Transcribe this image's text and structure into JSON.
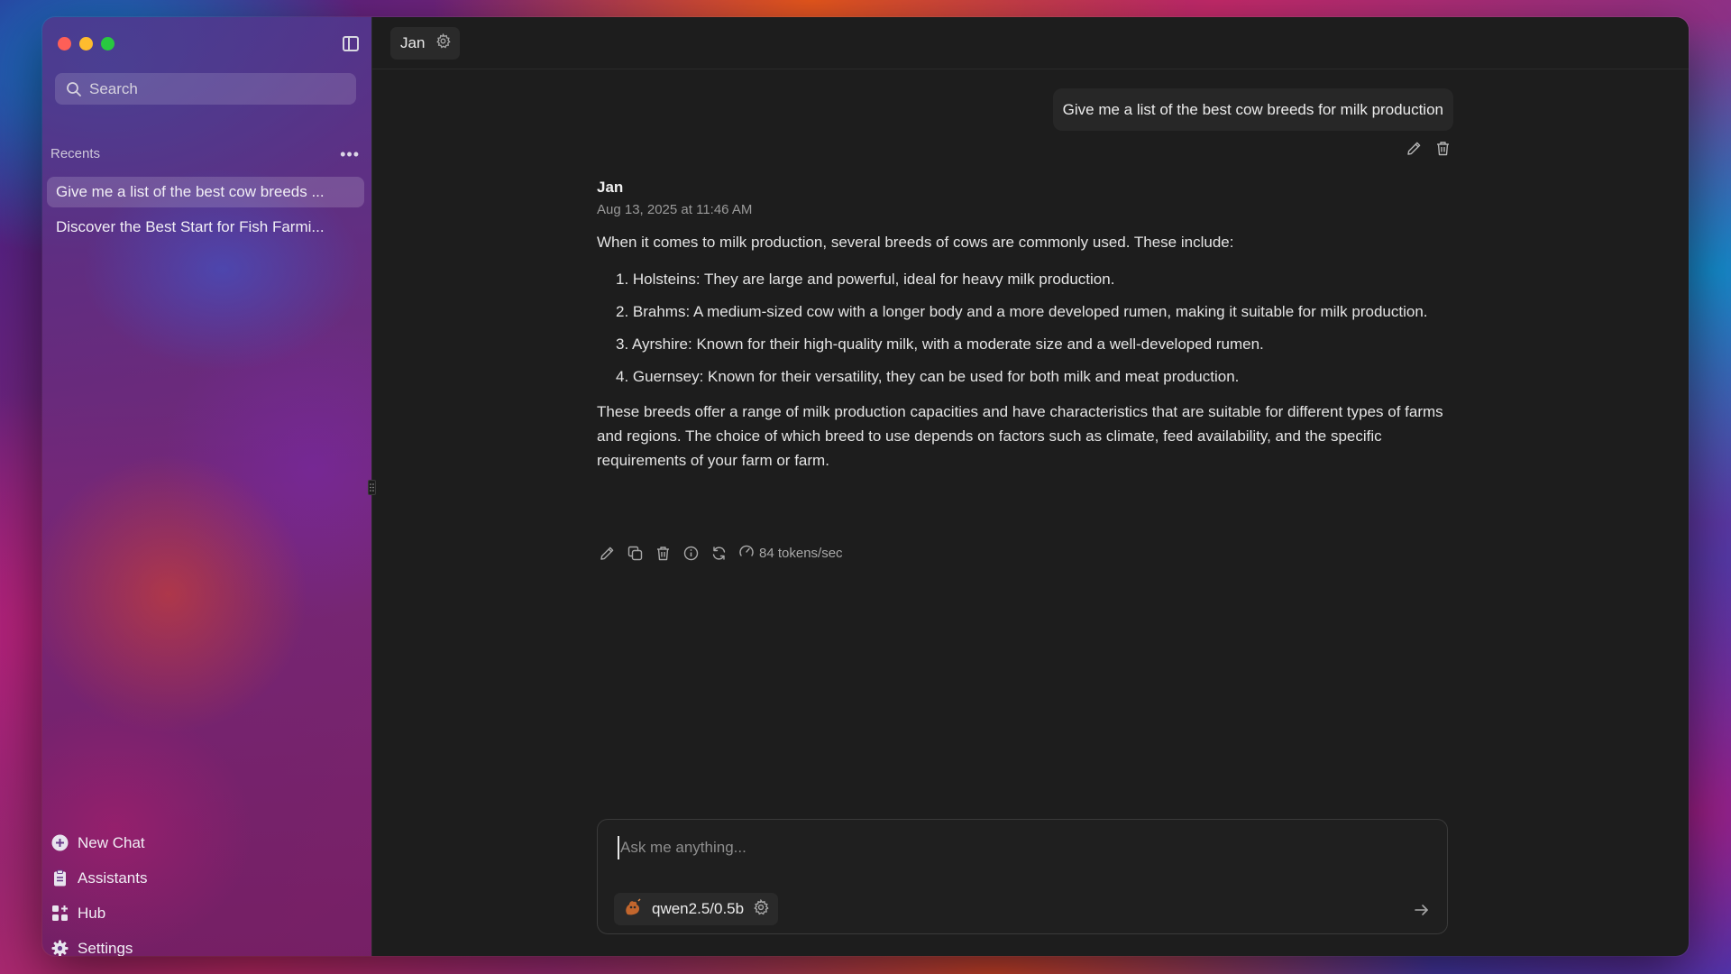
{
  "sidebar": {
    "search_placeholder": "Search",
    "recents_label": "Recents",
    "recents": [
      {
        "label": "Give me a list of the best cow breeds ..."
      },
      {
        "label": "Discover the Best Start for Fish Farmi..."
      }
    ],
    "nav": [
      {
        "label": "New Chat",
        "icon": "plus-circle-icon"
      },
      {
        "label": "Assistants",
        "icon": "clipboard-icon"
      },
      {
        "label": "Hub",
        "icon": "grid-icon"
      },
      {
        "label": "Settings",
        "icon": "gear-icon"
      }
    ]
  },
  "topbar": {
    "assistant_name": "Jan"
  },
  "conversation": {
    "user_message": "Give me a list of the best cow breeds for milk production",
    "assistant": {
      "name": "Jan",
      "timestamp": "Aug 13, 2025 at 11:46 AM",
      "intro": "When it comes to milk production, several breeds of cows are commonly used. These include:",
      "items": [
        "1. Holsteins: They are large and powerful, ideal for heavy milk production.",
        "2. Brahms: A medium-sized cow with a longer body and a more developed rumen, making it suitable for milk production.",
        "3. Ayrshire: Known for their high-quality milk, with a moderate size and a well-developed rumen.",
        "4. Guernsey: Known for their versatility, they can be used for both milk and meat production."
      ],
      "outro": "These breeds offer a range of milk production capacities and have characteristics that are suitable for different types of farms and regions. The choice of which breed to use depends on factors such as climate, feed availability, and the specific requirements of your farm or farm.",
      "tokens_per_sec": "84 tokens/sec"
    }
  },
  "composer": {
    "placeholder": "Ask me anything...",
    "model": "qwen2.5/0.5b"
  },
  "colors": {
    "window_bg": "#1d1d1d",
    "bubble_bg": "#272727",
    "close": "#fe5f57",
    "minimize": "#febc2e",
    "zoom": "#28c840"
  }
}
